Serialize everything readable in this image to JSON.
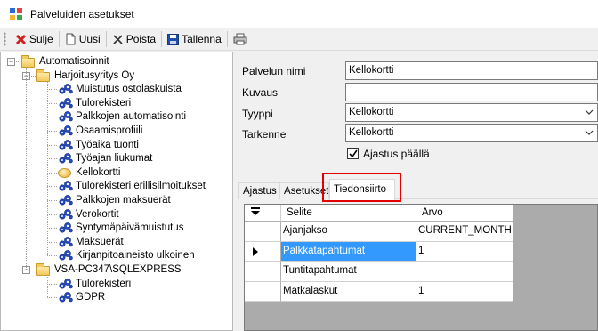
{
  "window": {
    "title": "Palveluiden asetukset"
  },
  "toolbar": {
    "close_label": "Sulje",
    "new_label": "Uusi",
    "delete_label": "Poista",
    "save_label": "Tallenna"
  },
  "tree": {
    "root": "Automatisoinnit",
    "company": "Harjoitusyritys Oy",
    "company_items": [
      "Muistutus ostolaskuista",
      "Tulorekisteri",
      "Palkkojen automatisointi",
      "Osaamisprofiili",
      "Työaika tuonti",
      "Työajan liukumat",
      "Kellokortti",
      "Tulorekisteri erillisilmoitukset",
      "Palkkojen maksuerät",
      "Verokortit",
      "Syntymäpäivämuistutus",
      "Maksuerät",
      "Kirjanpitoaineisto ulkoinen"
    ],
    "server": "VSA-PC347\\SQLEXPRESS",
    "server_items": [
      "Tulorekisteri",
      "GDPR"
    ],
    "selected": "Kellokortti"
  },
  "form": {
    "name_label": "Palvelun nimi",
    "name_value": "Kellokortti",
    "description_label": "Kuvaus",
    "description_value": "",
    "type_label": "Tyyppi",
    "type_value": "Kellokortti",
    "subtype_label": "Tarkenne",
    "subtype_value": "Kellokortti",
    "schedule_label": "Ajastus päällä",
    "schedule_checked": true
  },
  "tabs": [
    "Ajastus",
    "Asetukset",
    "Tiedonsiirto"
  ],
  "active_tab": "Tiedonsiirto",
  "grid": {
    "columns": [
      "Selite",
      "Arvo"
    ],
    "rows": [
      {
        "selite": "Ajanjakso",
        "arvo": "CURRENT_MONTH"
      },
      {
        "selite": "Palkkatapahtumat",
        "arvo": "1"
      },
      {
        "selite": "Tuntitapahtumat",
        "arvo": ""
      },
      {
        "selite": "Matkalaskut",
        "arvo": "1"
      }
    ],
    "selected_row": 1
  },
  "colors": {
    "selection": "#3399ff",
    "highlight": "#e00000"
  }
}
